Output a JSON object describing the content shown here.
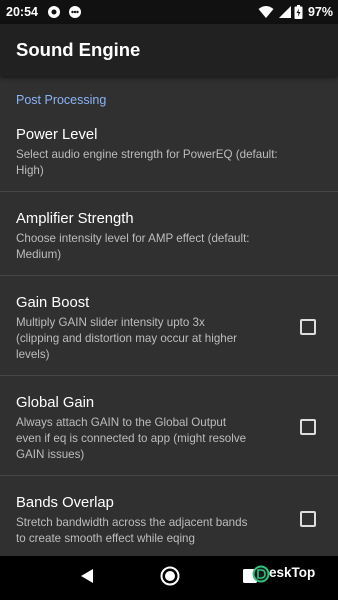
{
  "status_bar": {
    "time": "20:54",
    "battery": "97%",
    "icons": [
      "circle-status-icon",
      "dots-status-icon",
      "wifi-icon",
      "signal-icon",
      "battery-icon"
    ]
  },
  "app_bar": {
    "title": "Sound Engine"
  },
  "section": {
    "header": "Post Processing"
  },
  "preferences": [
    {
      "title": "Power Level",
      "summary_lines": [
        "Select audio engine strength for PowerEQ (default:",
        "High)"
      ]
    },
    {
      "title": "Amplifier Strength",
      "summary_lines": [
        "Choose intensity level for AMP effect (default:",
        "Medium)"
      ]
    },
    {
      "title": "Gain Boost",
      "summary_lines": [
        "Multiply GAIN slider intensity upto 3x",
        "(clipping and distortion may occur at higher",
        "levels)"
      ],
      "checked": false
    },
    {
      "title": "Global Gain",
      "summary_lines": [
        "Always attach GAIN to the Global Output",
        "even if eq is connected to app (might resolve",
        "GAIN issues)"
      ],
      "checked": false
    },
    {
      "title": "Bands Overlap",
      "summary_lines": [
        "Stretch bandwidth across the adjacent bands",
        "to create smooth effect while eqing"
      ],
      "checked": false
    }
  ],
  "nav_bar": {
    "icons": [
      "back-icon",
      "home-icon",
      "recents-icon"
    ]
  },
  "watermark": {
    "text": "eskTop"
  },
  "colors": {
    "background": "#303030",
    "app_bar": "#212121",
    "accent": "#8ab4f8",
    "summary_text": "#bdbdbd"
  }
}
